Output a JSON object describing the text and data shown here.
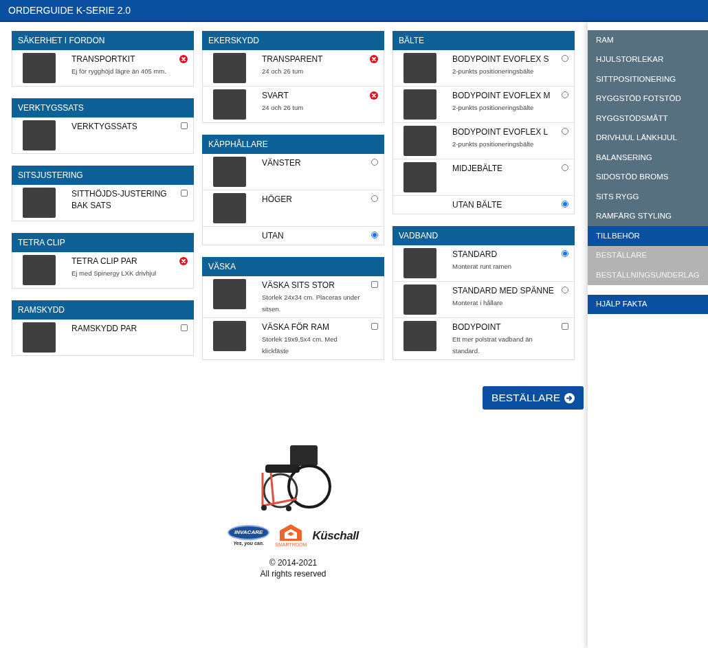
{
  "header": {
    "title": "ORDERGUIDE K-SERIE 2.0"
  },
  "columns": [
    {
      "sections": [
        {
          "title": "SÄKERHET I FORDON",
          "items": [
            {
              "kind": "unavailable",
              "image": true,
              "name": "TRANSPORTKIT",
              "desc": "Ej för rygghöjd lägre än 405 mm."
            }
          ]
        },
        {
          "title": "VERKTYGSSATS",
          "items": [
            {
              "kind": "checkbox",
              "checked": false,
              "image": true,
              "name": "VERKTYGSSATS"
            }
          ]
        },
        {
          "title": "SITSJUSTERING",
          "items": [
            {
              "kind": "checkbox",
              "checked": false,
              "image": true,
              "name": "SITTHÖJDS-JUSTERING BAK SATS"
            }
          ]
        },
        {
          "title": "TETRA CLIP",
          "items": [
            {
              "kind": "unavailable",
              "image": true,
              "name": "TETRA CLIP PAR",
              "desc": "Ej med Spinergy LXK drivhjul"
            }
          ]
        },
        {
          "title": "RAMSKYDD",
          "items": [
            {
              "kind": "checkbox",
              "checked": false,
              "image": true,
              "name": "RAMSKYDD PAR"
            }
          ]
        }
      ]
    },
    {
      "sections": [
        {
          "title": "EKERSKYDD",
          "items": [
            {
              "kind": "unavailable",
              "image": true,
              "name": "TRANSPARENT",
              "desc": "24 och 26 tum"
            },
            {
              "kind": "unavailable",
              "image": true,
              "name": "SVART",
              "desc": "24 och 26 tum"
            }
          ]
        },
        {
          "title": "KÄPPHÅLLARE",
          "items": [
            {
              "kind": "radio",
              "selected": false,
              "image": true,
              "name": "VÄNSTER"
            },
            {
              "kind": "radio",
              "selected": false,
              "image": true,
              "name": "HÖGER"
            },
            {
              "kind": "radio",
              "selected": true,
              "image": false,
              "name": "UTAN"
            }
          ]
        },
        {
          "title": "VÄSKA",
          "items": [
            {
              "kind": "checkbox",
              "checked": false,
              "image": true,
              "name": "VÄSKA SITS STOR",
              "desc": "Storlek 24x34 cm. Placeras under sitsen."
            },
            {
              "kind": "checkbox",
              "checked": false,
              "image": true,
              "name": "VÄSKA FÖR RAM",
              "desc": "Storlek 19x9,5x4 cm. Med klickfäste"
            }
          ]
        }
      ]
    },
    {
      "sections": [
        {
          "title": "BÄLTE",
          "items": [
            {
              "kind": "radio",
              "selected": false,
              "image": true,
              "name": "BODYPOINT EVOFLEX S",
              "desc": "2-punkts positioneringsbälte"
            },
            {
              "kind": "radio",
              "selected": false,
              "image": true,
              "name": "BODYPOINT EVOFLEX M",
              "desc": "2-punkts positioneringsbälte"
            },
            {
              "kind": "radio",
              "selected": false,
              "image": true,
              "name": "BODYPOINT EVOFLEX L",
              "desc": "2-punkts positioneringsbälte"
            },
            {
              "kind": "radio",
              "selected": false,
              "image": true,
              "name": "MIDJEBÄLTE"
            },
            {
              "kind": "radio",
              "selected": true,
              "image": false,
              "name": "UTAN BÄLTE"
            }
          ]
        },
        {
          "title": "VADBAND",
          "items": [
            {
              "kind": "radio",
              "selected": true,
              "image": true,
              "name": "STANDARD",
              "desc": "Monterat runt ramen"
            },
            {
              "kind": "radio",
              "selected": false,
              "image": true,
              "name": "STANDARD MED SPÄNNE",
              "desc": "Monterat i hållare"
            },
            {
              "kind": "checkbox",
              "checked": false,
              "image": true,
              "name": "BODYPOINT",
              "desc": "Ett mer polstrat vadband än standard."
            }
          ]
        }
      ]
    }
  ],
  "next_button": {
    "label": "BESTÄLLARE"
  },
  "footer": {
    "logos": [
      {
        "kind": "invacare",
        "name": "INVACARE",
        "tagline": "Yes, you can."
      },
      {
        "kind": "smartroom",
        "name": "SMARTROOM"
      },
      {
        "kind": "kuschall",
        "name": "Küschall"
      }
    ],
    "copyright": "© 2014-2021",
    "rights": "All rights reserved"
  },
  "sidebar": {
    "items": [
      {
        "label": "RAM",
        "selected": false,
        "disabled": false
      },
      {
        "label": "HJULSTORLEKAR",
        "selected": false,
        "disabled": false
      },
      {
        "label": "SITTPOSITIONERING",
        "selected": false,
        "disabled": false
      },
      {
        "label": "RYGGSTÖD FOTSTÖD",
        "selected": false,
        "disabled": false
      },
      {
        "label": "RYGGSTÖDSMÅTT",
        "selected": false,
        "disabled": false
      },
      {
        "label": "DRIVHJUL LÄNKHJUL",
        "selected": false,
        "disabled": false
      },
      {
        "label": "BALANSERING",
        "selected": false,
        "disabled": false
      },
      {
        "label": "SIDOSTÖD BROMS",
        "selected": false,
        "disabled": false
      },
      {
        "label": "SITS RYGG",
        "selected": false,
        "disabled": false
      },
      {
        "label": "RAMFÄRG STYLING",
        "selected": false,
        "disabled": false
      },
      {
        "label": "TILLBEHÖR",
        "selected": true,
        "disabled": false
      },
      {
        "label": "BESTÄLLARE",
        "selected": false,
        "disabled": true
      },
      {
        "label": "BESTÄLLNINGSUNDERLAG",
        "selected": false,
        "disabled": true
      }
    ],
    "help": {
      "label": "HJÄLP FAKTA"
    }
  }
}
